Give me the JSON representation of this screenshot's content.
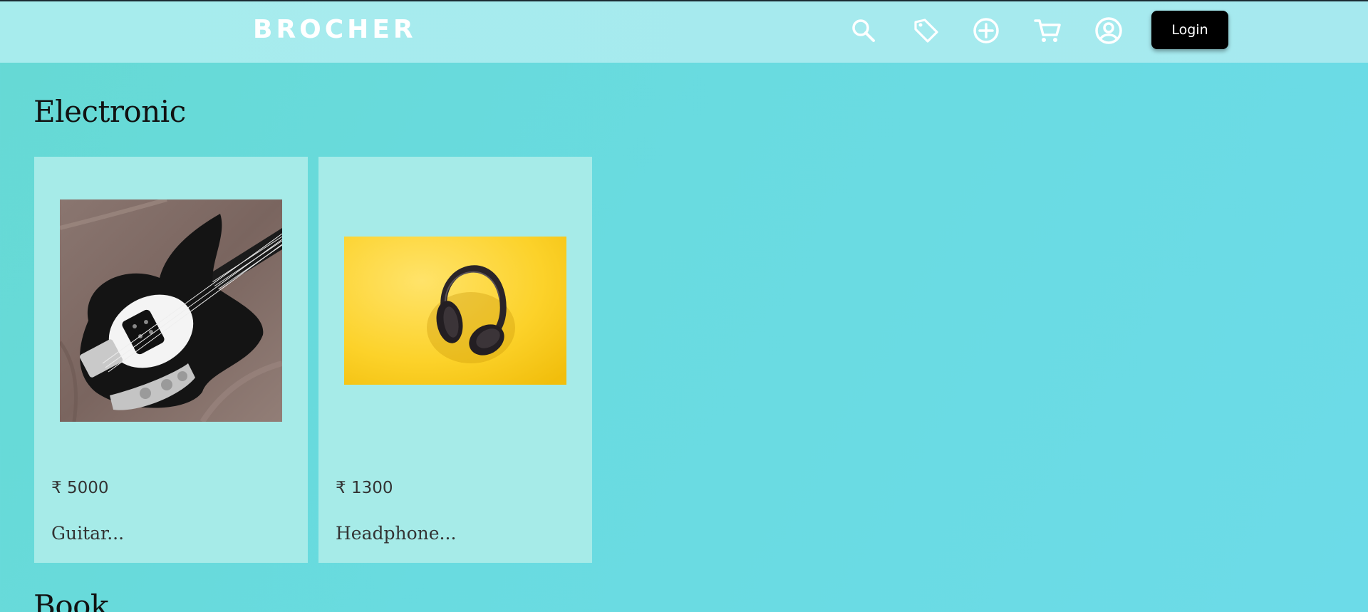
{
  "header": {
    "logo": "BROCHER",
    "icons": [
      "search-icon",
      "tag-icon",
      "add-circle-icon",
      "cart-icon",
      "account-icon"
    ],
    "login_label": "Login"
  },
  "sections": [
    {
      "title": "Electronic",
      "products": [
        {
          "price": "₹ 5000",
          "name": "Guitar...",
          "image": "bass-guitar-photo"
        },
        {
          "price": "₹ 1300",
          "name": "Headphone...",
          "image": "headphones-photo"
        }
      ]
    },
    {
      "title": "Book",
      "products": []
    }
  ],
  "colors": {
    "header_bg": "#a7eced",
    "page_bg": "#68dadd",
    "card_bg": "#a6ebe8",
    "login_bg": "#000000"
  }
}
